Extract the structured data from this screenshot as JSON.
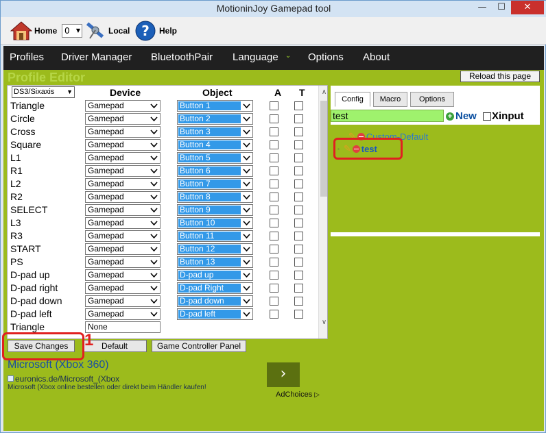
{
  "window": {
    "title": "MotioninJoy Gamepad tool",
    "minimize": "—",
    "maximize": "☐",
    "close": "✕"
  },
  "toolbar": {
    "home": "Home",
    "index_value": "0",
    "local": "Local",
    "help": "Help"
  },
  "menu": [
    "Profiles",
    "Driver Manager",
    "BluetoothPair",
    "Language",
    "Options",
    "About"
  ],
  "profile_editor": {
    "title": "Profile Editor",
    "reload_button": "Reload this page",
    "controller_type": "DS3/Sixaxis",
    "headers": {
      "device": "Device",
      "object": "Object",
      "a": "A",
      "t": "T"
    },
    "rows": [
      {
        "label": "Triangle",
        "device": "Gamepad",
        "object": "Button 1"
      },
      {
        "label": "Circle",
        "device": "Gamepad",
        "object": "Button 2"
      },
      {
        "label": "Cross",
        "device": "Gamepad",
        "object": "Button 3"
      },
      {
        "label": "Square",
        "device": "Gamepad",
        "object": "Button 4"
      },
      {
        "label": "L1",
        "device": "Gamepad",
        "object": "Button 5"
      },
      {
        "label": "R1",
        "device": "Gamepad",
        "object": "Button 6"
      },
      {
        "label": "L2",
        "device": "Gamepad",
        "object": "Button 7"
      },
      {
        "label": "R2",
        "device": "Gamepad",
        "object": "Button 8"
      },
      {
        "label": "SELECT",
        "device": "Gamepad",
        "object": "Button 9"
      },
      {
        "label": "L3",
        "device": "Gamepad",
        "object": "Button 10"
      },
      {
        "label": "R3",
        "device": "Gamepad",
        "object": "Button 11"
      },
      {
        "label": "START",
        "device": "Gamepad",
        "object": "Button 12"
      },
      {
        "label": "PS",
        "device": "Gamepad",
        "object": "Button 13"
      },
      {
        "label": "D-pad up",
        "device": "Gamepad",
        "object": "D-pad up"
      },
      {
        "label": "D-pad right",
        "device": "Gamepad",
        "object": "D-pad Right"
      },
      {
        "label": "D-pad down",
        "device": "Gamepad",
        "object": "D-pad down"
      },
      {
        "label": "D-pad left",
        "device": "Gamepad",
        "object": "D-pad left"
      }
    ],
    "extra_row": {
      "label": "Triangle",
      "device": "None"
    },
    "buttons": {
      "save": "Save Changes",
      "default": "Default",
      "panel": "Game Controller Panel"
    },
    "annotation_number": "1"
  },
  "ad": {
    "title": "Microsoft (Xbox 360)",
    "url": "euronics.de/Microsoft_(Xbox",
    "description": "Microsoft (Xbox online bestellen oder direkt beim Händler kaufen!",
    "arrow": "›",
    "adchoices": "AdChoices"
  },
  "right_panel": {
    "tabs": [
      "Config",
      "Macro",
      "Options"
    ],
    "search_value": "test",
    "new_label": "New",
    "xinput_label": "Xinput",
    "profiles": [
      "Custom-Default",
      "test"
    ]
  },
  "colors": {
    "accent_green": "#9cbb1c",
    "menubar": "#202020",
    "selected_blue": "#3399e8",
    "annotation_red": "#e02020"
  }
}
